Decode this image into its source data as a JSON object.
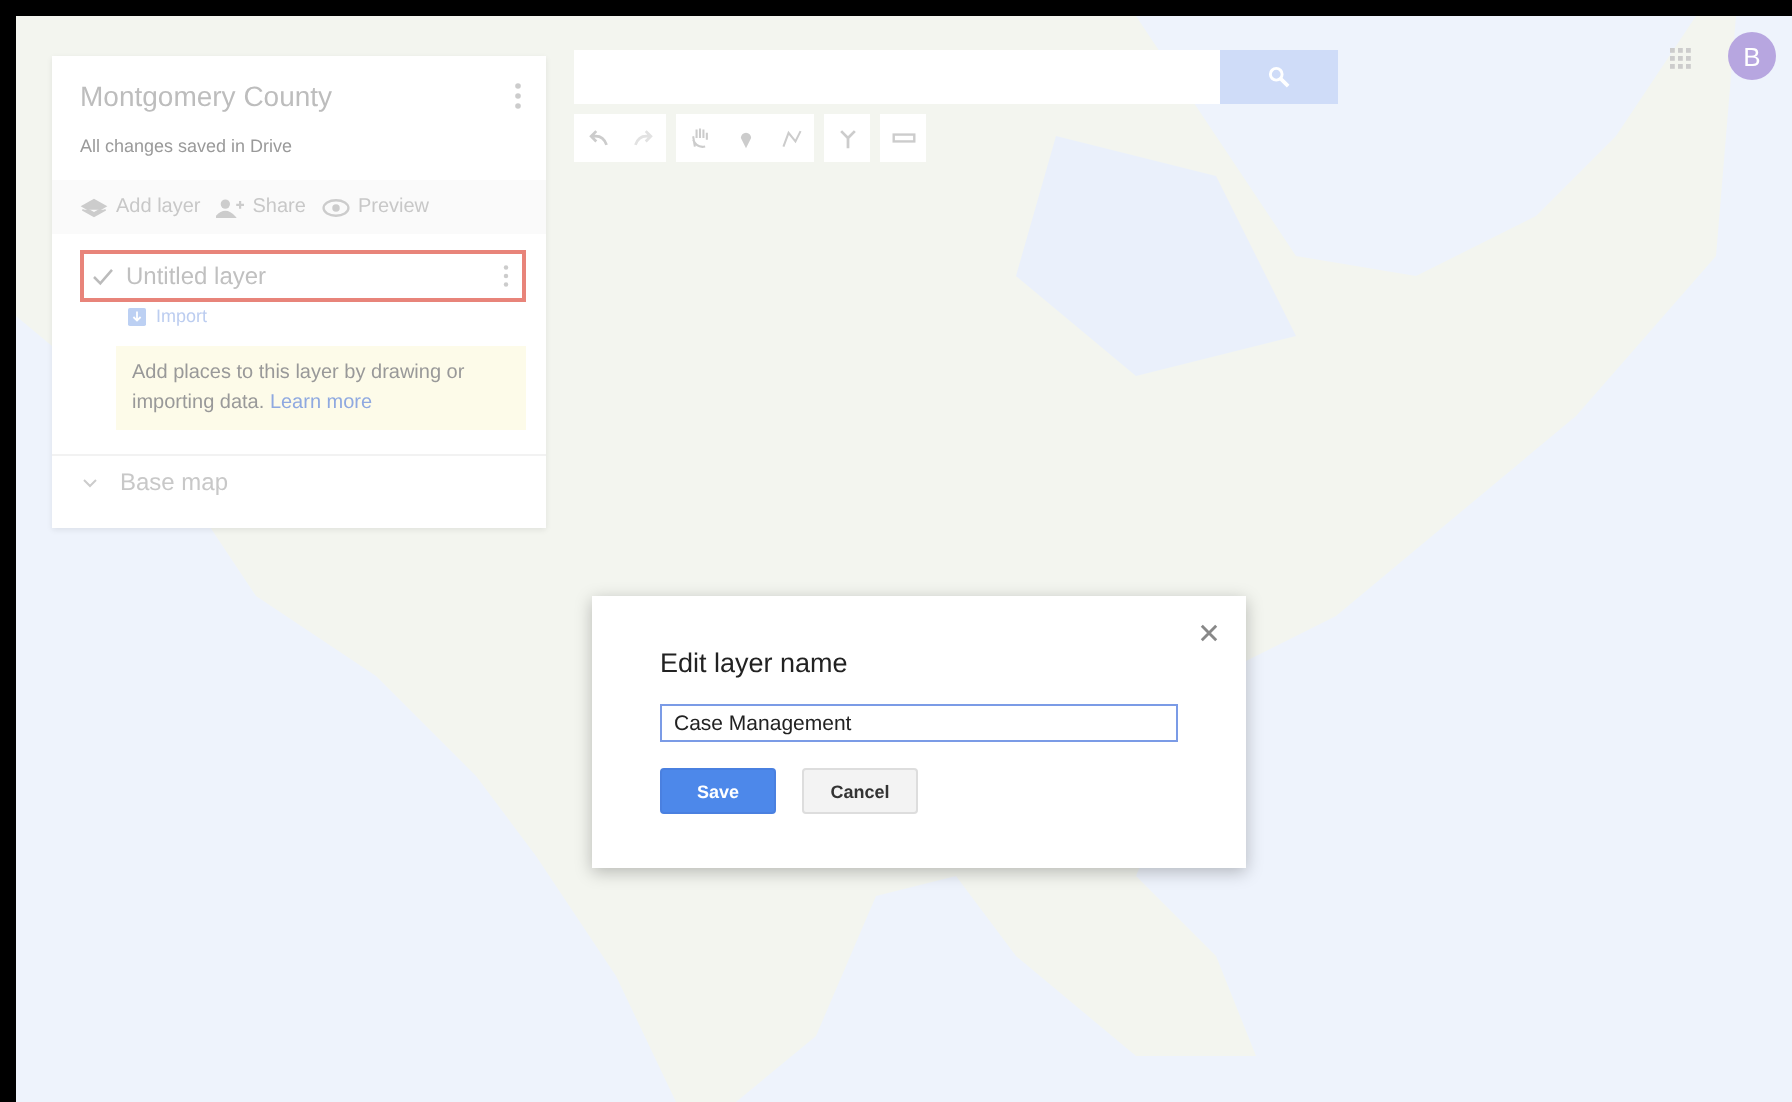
{
  "panel": {
    "title": "Montgomery County",
    "status": "All changes saved in Drive",
    "actions": [
      {
        "kind": "add_layer",
        "label": "Add layer"
      },
      {
        "kind": "share",
        "label": "Share"
      },
      {
        "kind": "preview",
        "label": "Preview"
      }
    ],
    "layers": [
      {
        "name": "Untitled layer",
        "checked": true,
        "selected": true,
        "import_label": "Import",
        "hint": "Add places to this layer by drawing or importing data.",
        "hint_link": "Learn more"
      }
    ],
    "base_map": {
      "label": "Base map"
    }
  },
  "toolbar": [
    {
      "kind": "undo"
    },
    {
      "kind": "redo"
    },
    {
      "kind": "pan"
    },
    {
      "kind": "marker"
    },
    {
      "kind": "line"
    },
    {
      "kind": "route"
    },
    {
      "kind": "ruler"
    }
  ],
  "account": {
    "initial": "B"
  },
  "dialog": {
    "title": "Edit layer name",
    "value": "Case Management",
    "buttons": [
      {
        "kind": "primary",
        "label": "Save"
      },
      {
        "kind": "secondary",
        "label": "Cancel"
      }
    ]
  }
}
